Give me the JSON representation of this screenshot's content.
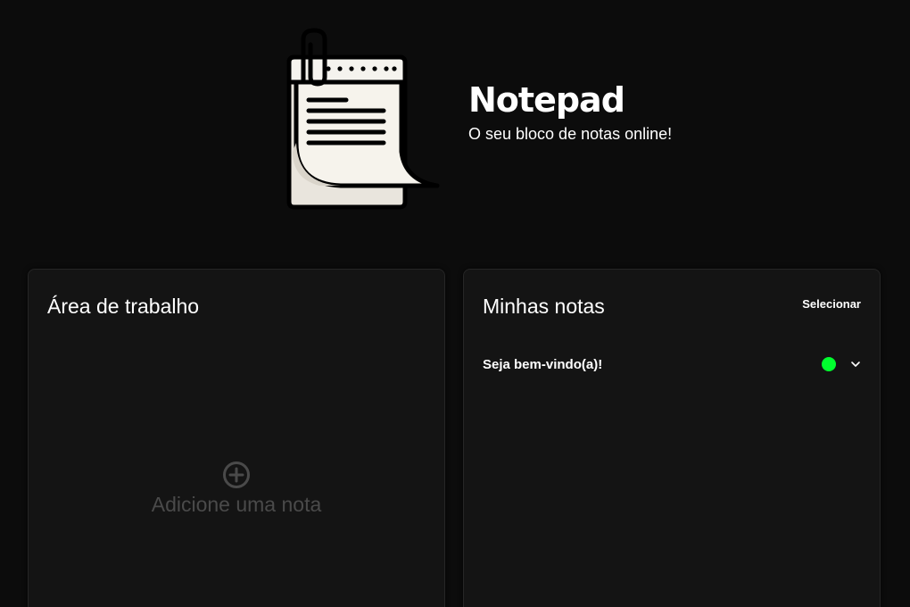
{
  "header": {
    "title": "Notepad",
    "subtitle": "O seu bloco de notas online!",
    "logo_icon": "notepad-paperclip-icon"
  },
  "workspace": {
    "title": "Área de trabalho",
    "add_note_label": "Adicione uma nota",
    "add_icon": "plus-circle-icon"
  },
  "notes_panel": {
    "title": "Minhas notas",
    "select_label": "Selecionar",
    "notes": [
      {
        "title": "Seja bem-vindo(a)!",
        "status_color": "#00ff2e",
        "expand_icon": "chevron-down-icon"
      }
    ]
  },
  "colors": {
    "background": "#0c0c0c",
    "panel": "#141414",
    "status_active": "#00ff2e",
    "muted_text": "#4a4a4a"
  }
}
